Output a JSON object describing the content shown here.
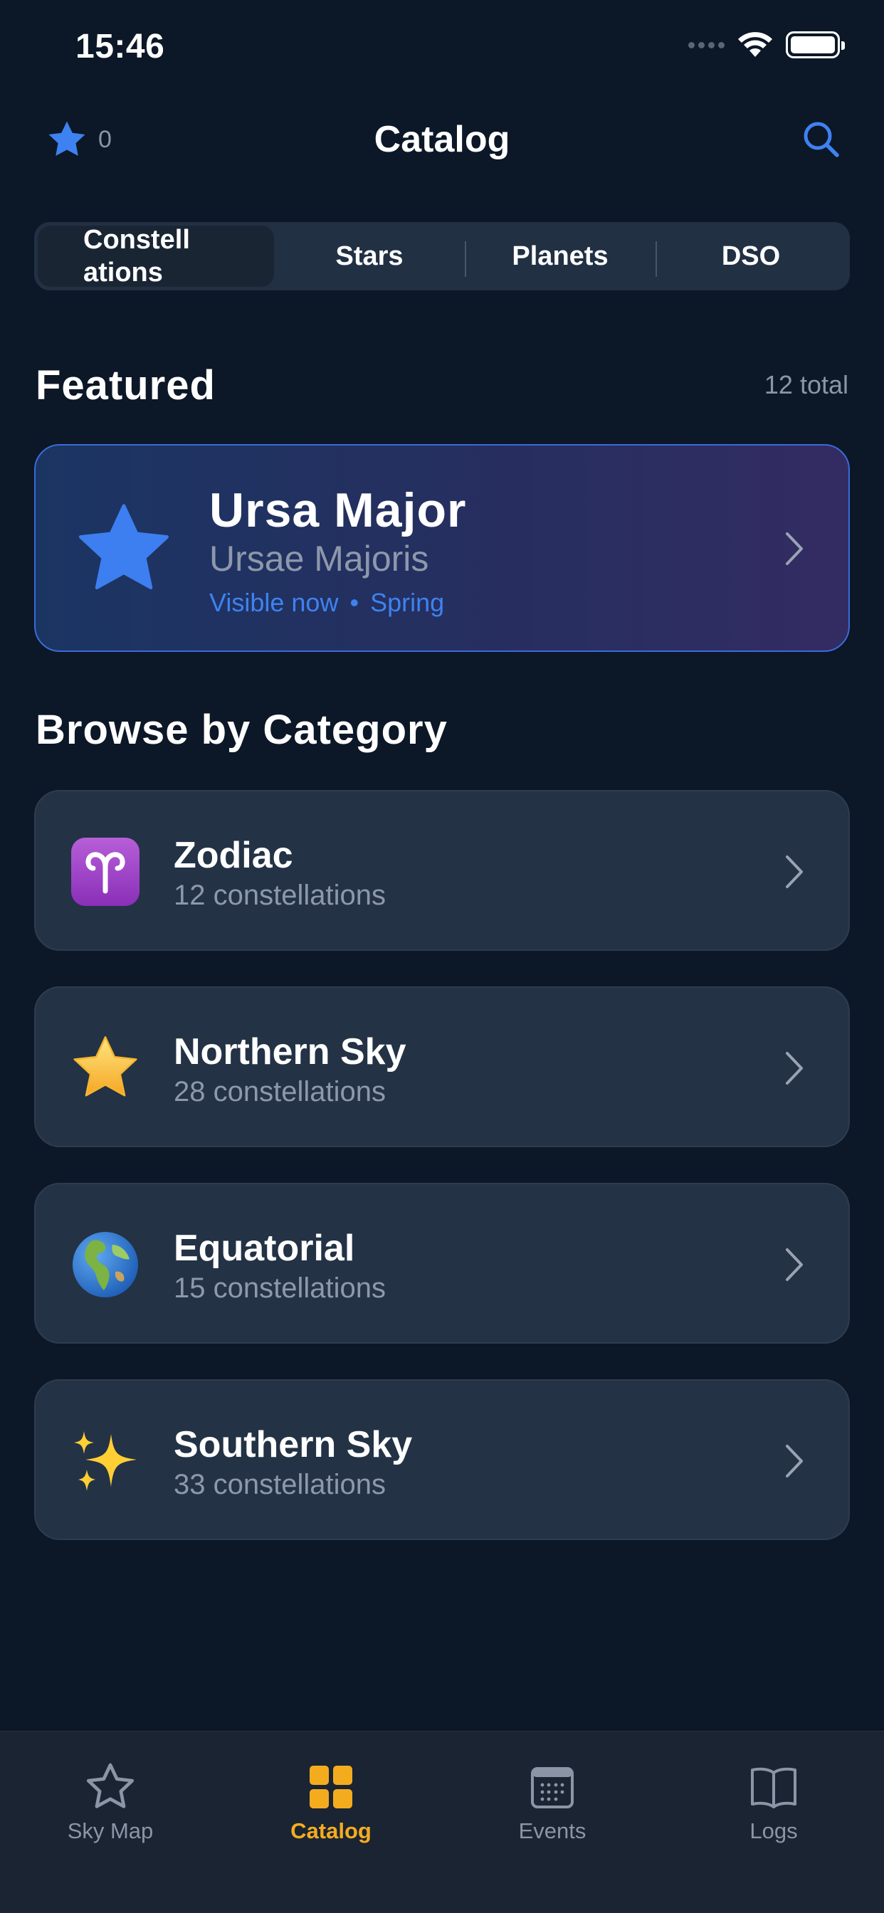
{
  "status": {
    "time": "15:46"
  },
  "nav": {
    "favorites_count": "0",
    "title": "Catalog"
  },
  "segments": [
    {
      "label": "Constell\nations",
      "selected": true
    },
    {
      "label": "Stars",
      "selected": false
    },
    {
      "label": "Planets",
      "selected": false
    },
    {
      "label": "DSO",
      "selected": false
    }
  ],
  "featured": {
    "heading": "Featured",
    "count_label": "12 total",
    "card": {
      "name": "Ursa Major",
      "latin": "Ursae Majoris",
      "visibility": "Visible now",
      "separator": "•",
      "season": "Spring"
    }
  },
  "browse": {
    "heading": "Browse by Category",
    "categories": [
      {
        "name": "Zodiac",
        "subtitle": "12 constellations",
        "icon": "aries-icon"
      },
      {
        "name": "Northern Sky",
        "subtitle": "28 constellations",
        "icon": "star-icon"
      },
      {
        "name": "Equatorial",
        "subtitle": "15 constellations",
        "icon": "globe-icon"
      },
      {
        "name": "Southern Sky",
        "subtitle": "33 constellations",
        "icon": "sparkles-icon"
      }
    ]
  },
  "tabs": [
    {
      "label": "Sky Map",
      "icon": "star-outline-icon",
      "active": false
    },
    {
      "label": "Catalog",
      "icon": "grid-icon",
      "active": true
    },
    {
      "label": "Events",
      "icon": "calendar-icon",
      "active": false
    },
    {
      "label": "Logs",
      "icon": "book-icon",
      "active": false
    }
  ],
  "colors": {
    "background": "#0c1727",
    "accent_blue": "#3e82f1",
    "accent_gold": "#f4ac1f",
    "card": "#233245"
  }
}
